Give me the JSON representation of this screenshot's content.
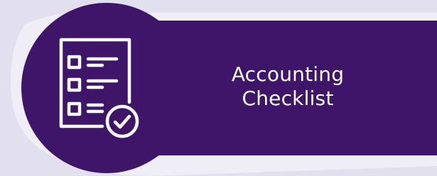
{
  "banner": {
    "title_line_1": "Accounting",
    "title_line_2": "Checklist",
    "icon": "checklist-icon",
    "accent_color": "#3f1569",
    "background_color": "#e2dfee"
  }
}
